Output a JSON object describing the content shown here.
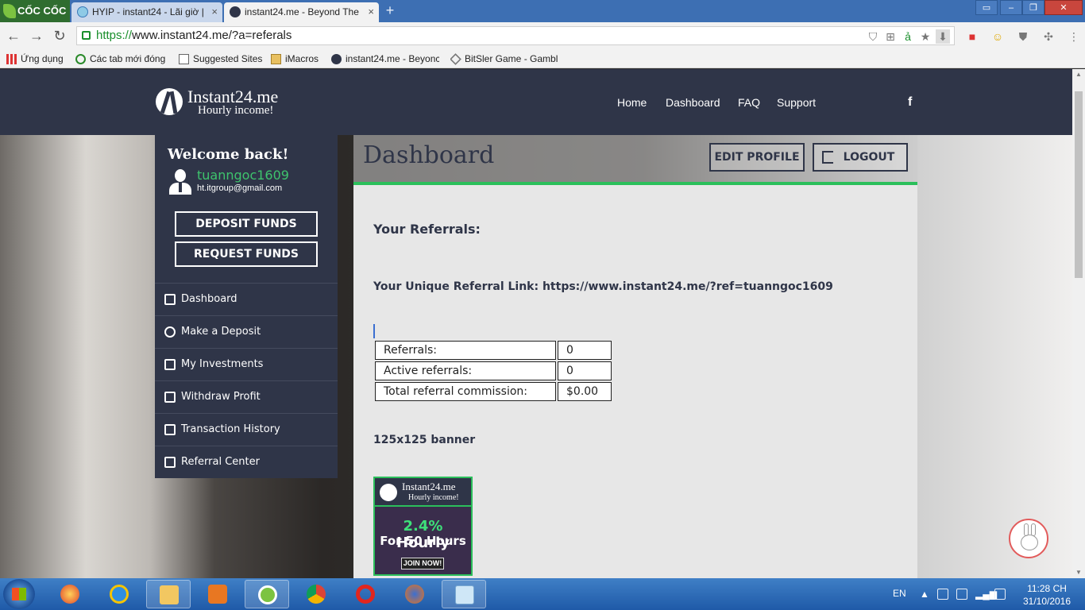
{
  "browser": {
    "brand": "CỐC CỐC",
    "tabs": [
      {
        "title": "HYIP - instant24 - Lãi giờ |",
        "close": "×"
      },
      {
        "title": "instant24.me - Beyond The",
        "close": "×"
      }
    ],
    "new_tab": "+",
    "window_controls": {
      "minimize": "–",
      "maximize": "❐",
      "close": "✕"
    },
    "nav": {
      "back": "←",
      "forward": "→",
      "reload": "↻"
    },
    "url_scheme": "https://",
    "url_rest": "www.instant24.me/?a=referals",
    "bookmarks": [
      "Ứng dụng",
      "Các tab mới đóng",
      "Suggested Sites",
      "iMacros",
      "instant24.me - Beyonc",
      "BitSler Game - Gambl"
    ]
  },
  "site": {
    "logo_name": "Instant24.me",
    "logo_tagline": "Hourly income!",
    "nav": [
      "Home",
      "Dashboard",
      "FAQ",
      "Support"
    ],
    "facebook": "f"
  },
  "sidebar": {
    "welcome": "Welcome back!",
    "username": "tuanngoc1609",
    "email": "ht.itgroup@gmail.com",
    "deposit_btn": "DEPOSIT FUNDS",
    "request_btn": "REQUEST FUNDS",
    "menu": [
      "Dashboard",
      "Make a Deposit",
      "My Investments",
      "Withdraw Profit",
      "Transaction History",
      "Referral Center"
    ]
  },
  "main": {
    "title": "Dashboard",
    "edit_profile": "EDIT PROFILE",
    "logout": "LOGOUT",
    "referrals_heading": "Your Referrals:",
    "ref_link_label": "Your Unique Referral Link: https://www.instant24.me/?ref=tuanngoc1609",
    "table": [
      {
        "label": "Referrals:",
        "value": "0"
      },
      {
        "label": "Active referrals:",
        "value": "0"
      },
      {
        "label": "Total referral commission:",
        "value": "$0.00"
      }
    ],
    "banner_heading": "125x125 banner",
    "banner": {
      "name": "Instant24.me",
      "tagline": "Hourly income!",
      "rate_pct": "2.4%",
      "rate_word": " Hourly",
      "hours": "For 50 Hours",
      "join": "JOIN NOW!"
    }
  },
  "taskbar": {
    "lang": "EN",
    "time": "11:28 CH",
    "date": "31/10/2016"
  },
  "colors": {
    "accent_green": "#2bbf5b",
    "navy": "#2f3548",
    "username_green": "#3ec46d"
  }
}
